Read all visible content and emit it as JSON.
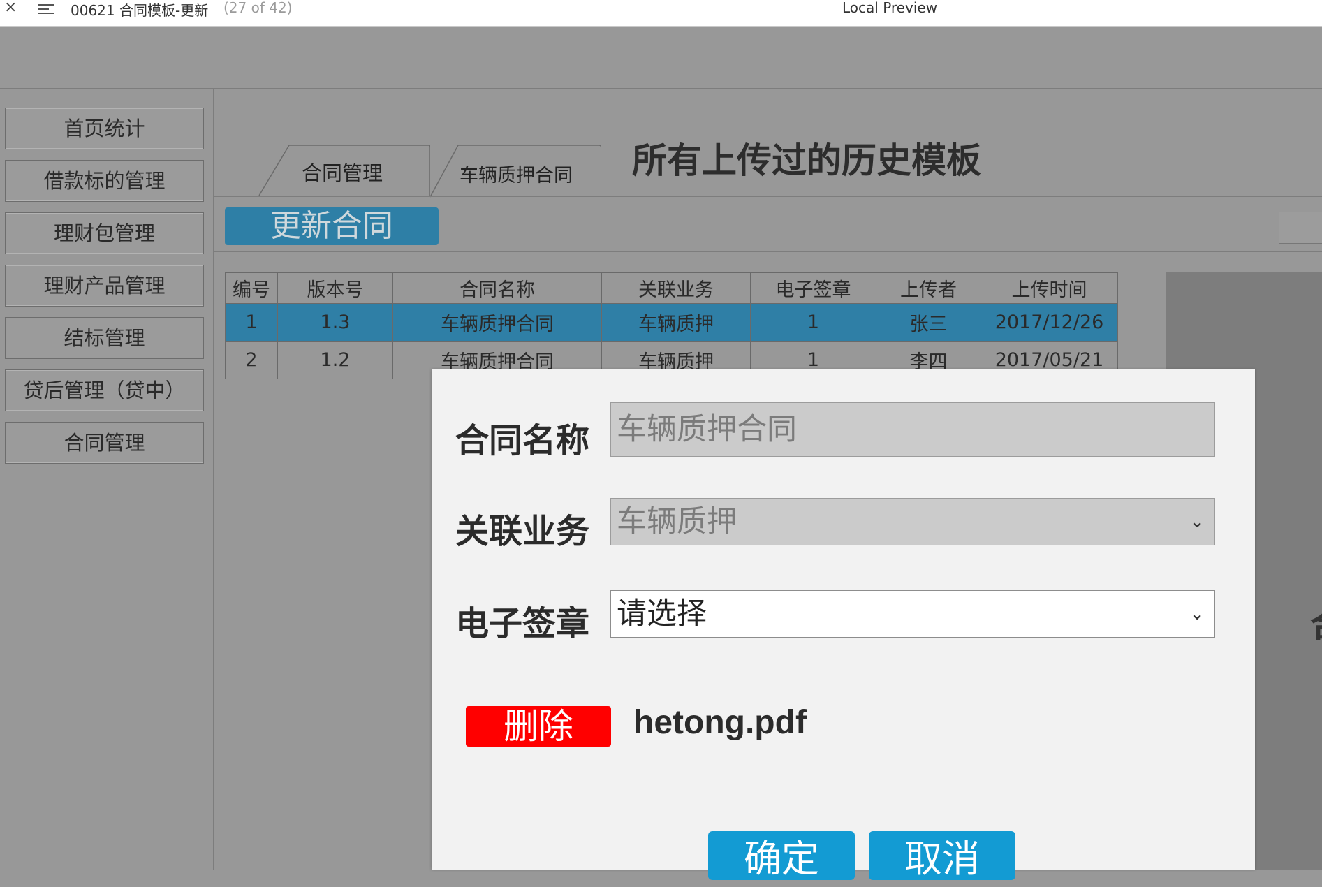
{
  "window": {
    "document_title": "00621 合同模板-更新",
    "page_count": "(27 of 42)",
    "app_title": "Local Preview"
  },
  "sidebar": {
    "items": [
      {
        "label": "首页统计"
      },
      {
        "label": "借款标的管理"
      },
      {
        "label": "理财包管理"
      },
      {
        "label": "理财产品管理"
      },
      {
        "label": "结标管理"
      },
      {
        "label": "贷后管理（贷中）"
      },
      {
        "label": "合同管理"
      }
    ]
  },
  "tabs": [
    {
      "label": "合同管理"
    },
    {
      "label": "车辆质押合同"
    }
  ],
  "page_title": "所有上传过的历史模板",
  "toolbar": {
    "update_label": "更新合同"
  },
  "table": {
    "headers": [
      "编号",
      "版本号",
      "合同名称",
      "关联业务",
      "电子签章",
      "上传者",
      "上传时间"
    ],
    "rows": [
      [
        "1",
        "1.3",
        "车辆质押合同",
        "车辆质押",
        "1",
        "张三",
        "2017/12/26"
      ],
      [
        "2",
        "1.2",
        "车辆质押合同",
        "车辆质押",
        "1",
        "李四",
        "2017/05/21"
      ]
    ],
    "selected_row": 0
  },
  "right_panel_glyph": "合",
  "modal": {
    "contract_name_label": "合同名称",
    "contract_name_value": "车辆质押合同",
    "business_label": "关联业务",
    "business_value": "车辆质押",
    "seal_label": "电子签章",
    "seal_value": "请选择",
    "delete_label": "删除",
    "filename": "hetong.pdf",
    "confirm_label": "确定",
    "cancel_label": "取消"
  },
  "colors": {
    "accent": "#2e7fa6",
    "danger": "#ff0000",
    "primary_button": "#139bd3",
    "overlay_background": "#989898"
  }
}
